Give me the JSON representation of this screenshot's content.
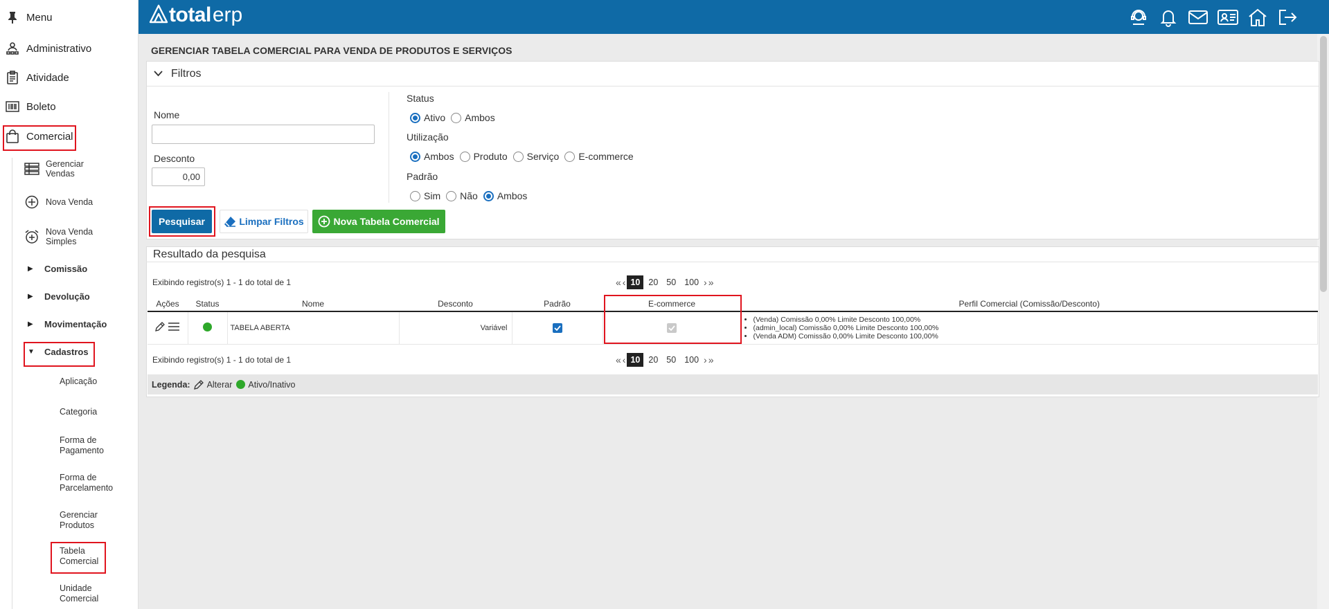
{
  "sidebar": {
    "top_items": [
      {
        "label": "Menu",
        "icon": "pin-icon"
      },
      {
        "label": "Administrativo",
        "icon": "org-icon"
      },
      {
        "label": "Atividade",
        "icon": "clipboard-icon"
      },
      {
        "label": "Boleto",
        "icon": "barcode-icon"
      },
      {
        "label": "Comercial",
        "icon": "shopping-bag-icon"
      }
    ],
    "sub_items": [
      {
        "label_1": "Gerenciar",
        "label_2": "Vendas"
      },
      {
        "label_1": "Nova Venda",
        "label_2": ""
      },
      {
        "label_1": "Nova Venda",
        "label_2": "Simples"
      }
    ],
    "groups": [
      {
        "label": "Comissão",
        "expanded": false
      },
      {
        "label": "Devolução",
        "expanded": false
      },
      {
        "label": "Movimentação",
        "expanded": false
      },
      {
        "label": "Cadastros",
        "expanded": true
      }
    ],
    "leaves": [
      {
        "label_1": "Aplicação",
        "label_2": ""
      },
      {
        "label_1": "Categoria",
        "label_2": ""
      },
      {
        "label_1": "Forma de",
        "label_2": "Pagamento"
      },
      {
        "label_1": "Forma de",
        "label_2": "Parcelamento"
      },
      {
        "label_1": "Gerenciar",
        "label_2": "Produtos"
      },
      {
        "label_1": "Tabela",
        "label_2": "Comercial"
      },
      {
        "label_1": "Unidade",
        "label_2": "Comercial"
      }
    ]
  },
  "header": {
    "brand_bold": "total",
    "brand_light": "erp",
    "background": "#0f6aa6",
    "icons": [
      "support-icon",
      "bell-icon",
      "mail-icon",
      "id-card-icon",
      "home-icon",
      "logout-icon"
    ]
  },
  "page": {
    "title": "GERENCIAR TABELA COMERCIAL PARA VENDA DE PRODUTOS E SERVIÇOS"
  },
  "filters": {
    "title": "Filtros",
    "nome_label": "Nome",
    "nome_value": "",
    "desconto_label": "Desconto",
    "desconto_value": "0,00",
    "status_label": "Status",
    "status_options": [
      "Ativo",
      "Ambos"
    ],
    "status_selected": "Ativo",
    "utilizacao_label": "Utilização",
    "utilizacao_options": [
      "Ambos",
      "Produto",
      "Serviço",
      "E-commerce"
    ],
    "utilizacao_selected": "Ambos",
    "padrao_label": "Padrão",
    "padrao_options": [
      "Sim",
      "Não",
      "Ambos"
    ],
    "padrao_selected": "Ambos",
    "btn_search": "Pesquisar",
    "btn_clear": "Limpar Filtros",
    "btn_new": "Nova Tabela Comercial"
  },
  "results": {
    "title": "Resultado da pesquisa",
    "summary": "Exibindo registro(s) 1 - 1 do total de 1",
    "page_sizes": [
      "10",
      "20",
      "50",
      "100"
    ],
    "page_size_selected": "10",
    "columns": [
      "Ações",
      "Status",
      "Nome",
      "Desconto",
      "Padrão",
      "E-commerce",
      "Perfil Comercial (Comissão/Desconto)"
    ],
    "rows": [
      {
        "status": "ativo",
        "nome": "TABELA ABERTA",
        "desconto": "Variável",
        "padrao": true,
        "ecommerce": true,
        "perfil": [
          "(Venda) Comissão 0,00% Limite Desconto 100,00%",
          "(admin_local) Comissão 0,00% Limite Desconto 100,00%",
          "(Venda ADM) Comissão 0,00% Limite Desconto 100,00%"
        ]
      }
    ],
    "legend_label": "Legenda:",
    "legend_edit": "Alterar",
    "legend_status": "Ativo/Inativo"
  },
  "colors": {
    "primary": "#0f6aa6",
    "success": "#3aa835",
    "highlight": "#e0141e"
  }
}
